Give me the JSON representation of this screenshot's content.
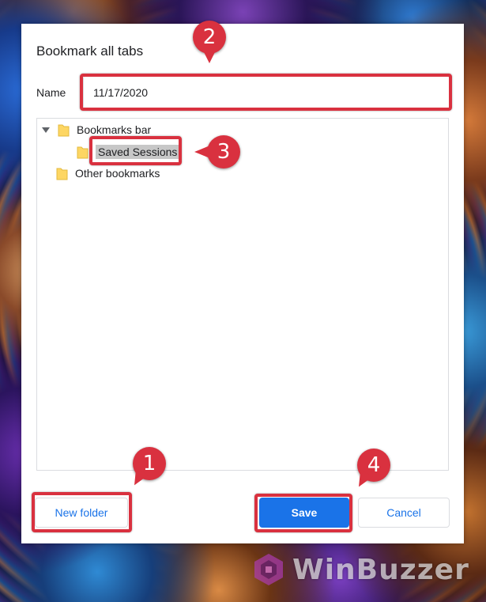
{
  "dialog": {
    "title": "Bookmark all tabs",
    "name_label": "Name",
    "name_value": "11/17/2020"
  },
  "tree": {
    "items": [
      {
        "label": "Bookmarks bar",
        "expanded": true,
        "icon": "folder-icon"
      },
      {
        "label": "Saved Sessions",
        "selected": true,
        "icon": "folder-icon"
      },
      {
        "label": "Other bookmarks",
        "icon": "folder-icon"
      }
    ]
  },
  "buttons": {
    "new_folder": "New folder",
    "save": "Save",
    "cancel": "Cancel"
  },
  "annotations": {
    "markers": [
      "1",
      "2",
      "3",
      "4"
    ],
    "color": "#d9313f"
  },
  "watermark": {
    "text": "WinBuzzer"
  },
  "colors": {
    "accent": "#1a73e8",
    "folder": "#fdd663",
    "selection": "#c7c7c7"
  }
}
